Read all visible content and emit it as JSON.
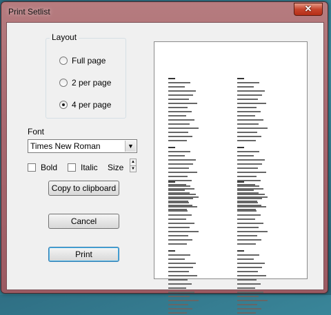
{
  "window": {
    "title": "Print Setlist",
    "close_label": "✕"
  },
  "layout": {
    "legend": "Layout",
    "options": [
      {
        "label": "Full page",
        "checked": false
      },
      {
        "label": "2 per page",
        "checked": false
      },
      {
        "label": "4 per page",
        "checked": true
      }
    ]
  },
  "font": {
    "label": "Font",
    "selected": "Times New Roman",
    "bold_label": "Bold",
    "italic_label": "Italic",
    "size_label": "Size",
    "spin_up": "▲",
    "spin_down": "▼",
    "dropdown_arrow": "▼"
  },
  "buttons": {
    "copy": "Copy to clipboard",
    "cancel": "Cancel",
    "print": "Print"
  },
  "icons": {
    "dropdown": "chevron-down-icon",
    "close": "close-icon"
  }
}
